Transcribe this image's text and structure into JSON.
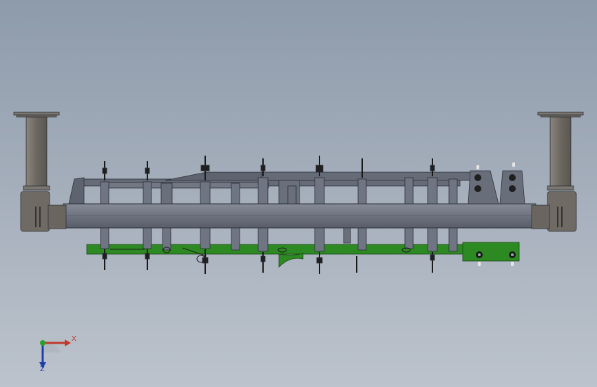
{
  "viewport": {
    "background_top": "#8e9bab",
    "background_bottom": "#bcc3cc"
  },
  "model": {
    "frame_color": "#5f6472",
    "bracket_color": "#2d8a22",
    "post_color": "#7a7670"
  },
  "triad": {
    "x_label": "X",
    "z_label": "Z",
    "x_color": "#c0392b",
    "z_color": "#1f3fa8",
    "origin_color": "#2aa02a"
  }
}
